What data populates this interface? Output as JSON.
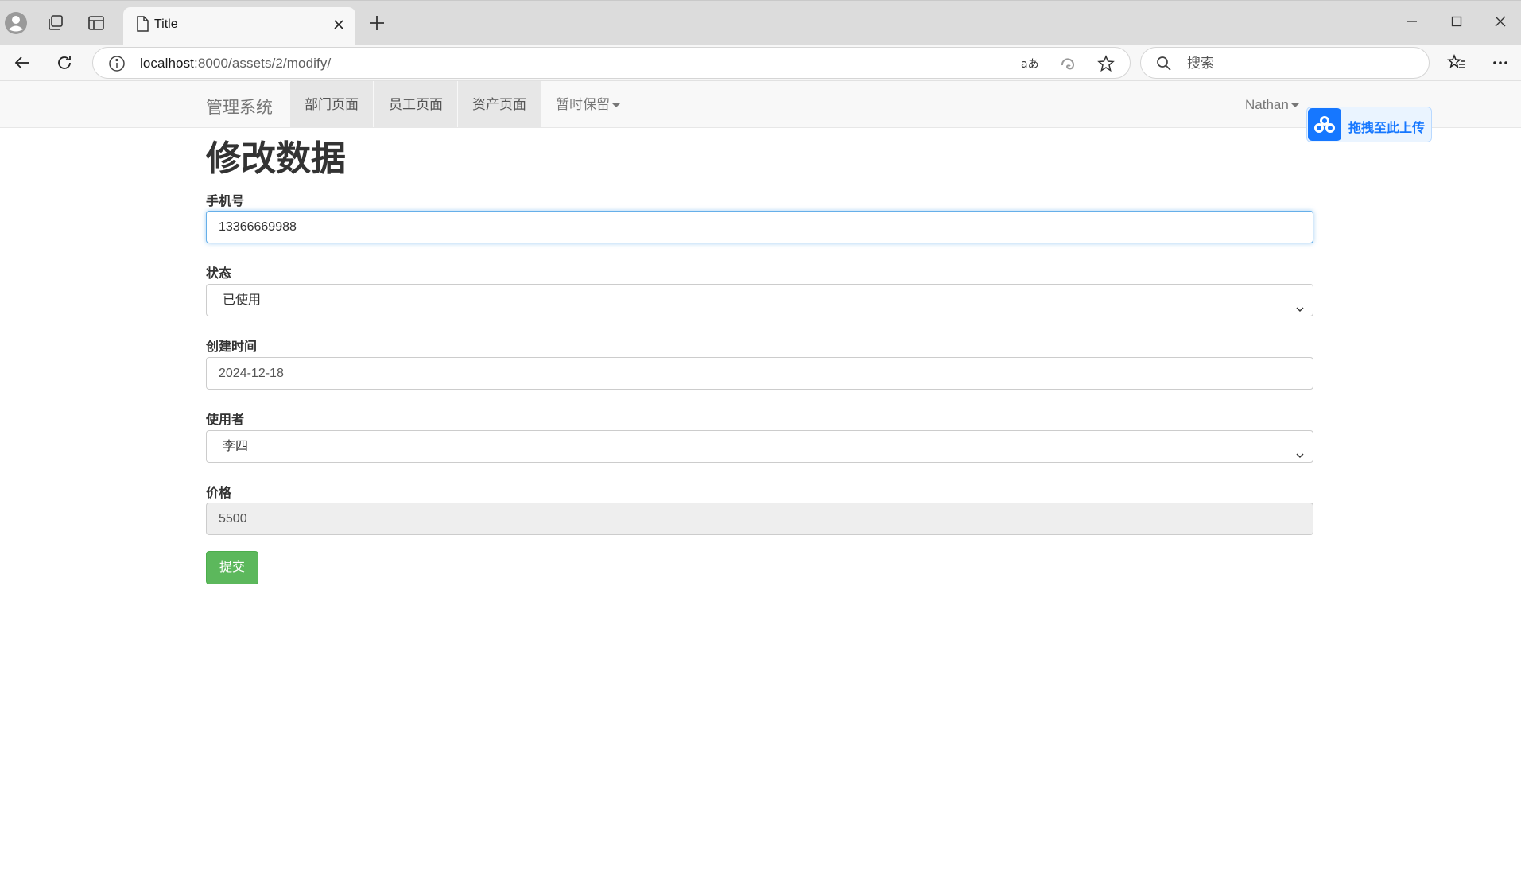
{
  "browser": {
    "tab_title": "Title",
    "url_host": "localhost",
    "url_path": ":8000/assets/2/modify/",
    "search_placeholder": "搜索"
  },
  "navbar": {
    "brand": "管理系统",
    "items": [
      {
        "label": "部门页面"
      },
      {
        "label": "员工页面"
      },
      {
        "label": "资产页面"
      }
    ],
    "dropdown_label": "暂时保留",
    "user_name": "Nathan"
  },
  "upload_widget": {
    "label": "拖拽至此上传"
  },
  "form": {
    "title": "修改数据",
    "phone": {
      "label": "手机号",
      "value": "13366669988"
    },
    "status": {
      "label": "状态",
      "value": "已使用"
    },
    "created": {
      "label": "创建时间",
      "value": "2024-12-18"
    },
    "user": {
      "label": "使用者",
      "value": "李四"
    },
    "price": {
      "label": "价格",
      "value": "5500"
    },
    "submit_label": "提交"
  }
}
